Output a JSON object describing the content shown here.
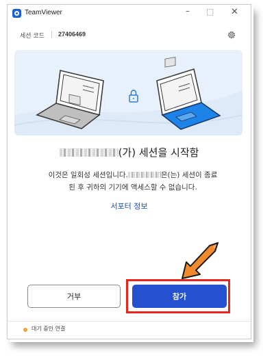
{
  "window": {
    "app_title": "TeamViewer",
    "minimize": "–",
    "maximize": "□",
    "close": "✕"
  },
  "session": {
    "label": "세션 코드",
    "code": "27406469"
  },
  "heading": {
    "suffix": "(가) 세션을 시작함"
  },
  "message": {
    "part1": "이것은 일회성 세션입니다.",
    "part2": "은(는) 세션이 종료",
    "line2": "된 후 귀하의 기기에 액세스할 수 없습니다."
  },
  "support_link": "서포터 정보",
  "buttons": {
    "decline": "거부",
    "join": "참가"
  },
  "status": {
    "text": "대기 중인 연결"
  },
  "colors": {
    "accent": "#2550cf",
    "highlight": "#e8241d",
    "status": "#f5a23d"
  }
}
